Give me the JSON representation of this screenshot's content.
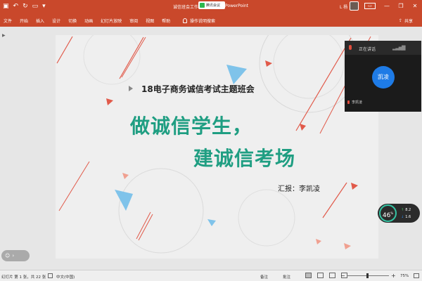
{
  "titlebar": {
    "doc_title": "诚信班会工作...",
    "meeting_label": "腾讯会议",
    "app_name": "PowerPoint",
    "user_name": "L 杨",
    "save_icon": "save-icon",
    "undo_icon": "undo-icon",
    "redo_icon": "redo-icon"
  },
  "menu": {
    "tabs": [
      "文件",
      "开始",
      "插入",
      "设计",
      "切换",
      "动画",
      "幻灯片放映",
      "审阅",
      "视图",
      "帮助"
    ],
    "tell_me": "操作说明搜索",
    "share": "共享"
  },
  "slide": {
    "subject": "18电子商务诚信考试主题班会",
    "headline_line1": "做诚信学生，",
    "headline_line2": "建诚信考场",
    "reporter": "汇报：李凯凌"
  },
  "video": {
    "speaking_label": "正在讲话",
    "participant_short": "凯凌",
    "participant_name": "李凯凌"
  },
  "perf": {
    "cpu_percent": "46",
    "upload": "8.2",
    "download": "1.6"
  },
  "statusbar": {
    "slide_info": "幻灯片 第 1 张，共 22 张",
    "language": "中文(中国)",
    "notes": "备注",
    "comments": "批注",
    "zoom": "75%"
  },
  "colors": {
    "accent": "#c9482b",
    "headline": "#1f9e82",
    "bubble": "#1e7be6"
  }
}
